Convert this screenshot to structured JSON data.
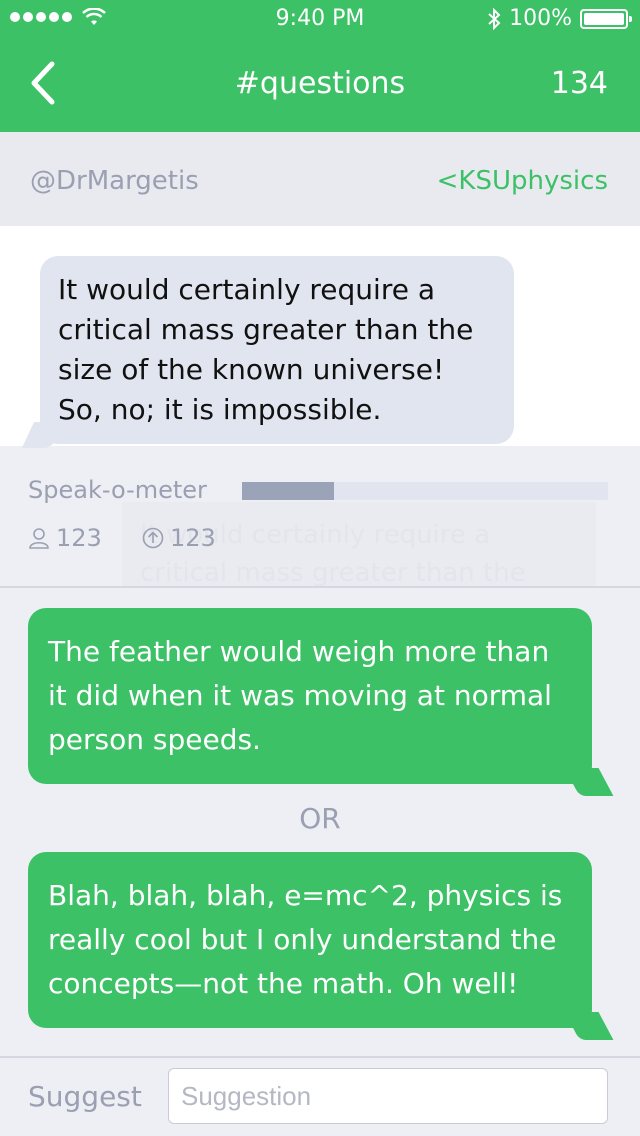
{
  "status_bar": {
    "time": "9:40 PM",
    "battery": "100%"
  },
  "nav": {
    "title": "#questions",
    "count": "134"
  },
  "meta": {
    "author": "@DrMargetis",
    "channel": "<KSUphysics"
  },
  "question": {
    "text": "It would certainly require a critical mass greater than the size of the known universe! So, no; it is impossible.",
    "ghost_text": "It would certainly require a critical mass greater than the"
  },
  "speak_o_meter": {
    "label": "Speak-o-meter",
    "level": 0.25
  },
  "stats": {
    "listeners": "123",
    "upvotes": "123"
  },
  "answers": [
    {
      "text": "The feather would weigh more than it did when it was moving at normal person speeds."
    },
    {
      "text": "Blah, blah, blah, e=mc^2, physics is really cool but I only understand the concepts—not the math. Oh well!"
    }
  ],
  "or_label": "OR",
  "footer": {
    "suggest_label": "Suggest",
    "placeholder": "Suggestion"
  },
  "colors": {
    "accent": "#3dc166",
    "question_bubble": "#e1e5ef",
    "muted_text": "#9aa0b2"
  }
}
